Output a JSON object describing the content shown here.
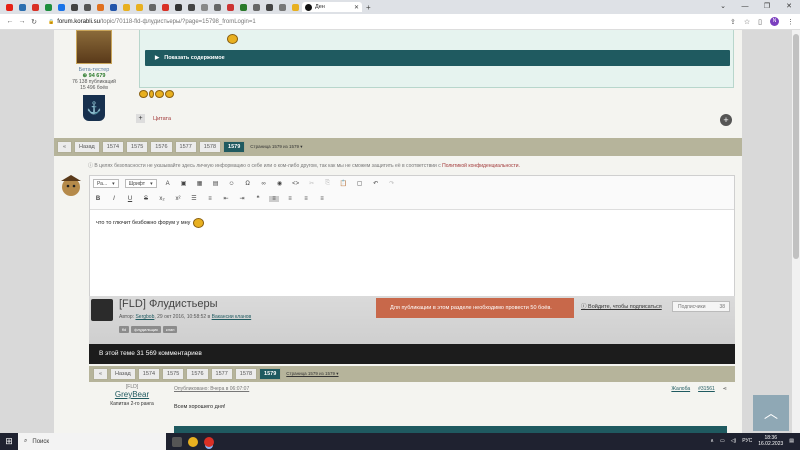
{
  "browser": {
    "active_tab_label": "Ден",
    "url_host": "forum.korabli.su",
    "url_path": "/topic/70118-fld-флудистьеры/?page=15798_fromLogin=1",
    "profile_initial": "N"
  },
  "post1": {
    "user_role": "Бета-тестер",
    "reputation": "94 679",
    "publications": "76 138 публикаций",
    "battles": "15 496 боёв",
    "spoiler_label": "Показать содержимое",
    "quote_label": "Цитата"
  },
  "pagination_top": {
    "back": "Назад",
    "pages": [
      "1574",
      "1575",
      "1576",
      "1577",
      "1578",
      "1579"
    ],
    "of_label": "Страница 1579 из 1579 ▾"
  },
  "privacy": {
    "text": "В целях безопасности не указывайте здесь личную информацию о себе или о ком-либо другом, так как мы не сможем защитить её в соответствии с",
    "link": "Политикой конфиденциальности."
  },
  "editor": {
    "font_size_select": "Ра...",
    "font_select": "Шрифт",
    "text": "что то глючит безбожно форум у мну"
  },
  "topic": {
    "title": "[FLD] Флудистьеры",
    "author_prefix": "Автор:",
    "author": "Sergbob",
    "date": ", 29 окт 2016, 10:58:52 в",
    "section": "Вакансии кланов",
    "tags": [
      "fld",
      "флудильщик",
      "клан"
    ],
    "warning": "Для публикации в этом разделе необходимо провести 50 боёв.",
    "follow": "Войдите, чтобы подписаться",
    "subscribers": "Подписчики",
    "subscribers_count": "38",
    "comments": "В этой теме 31 569 комментариев"
  },
  "post2": {
    "group": "[FLD]",
    "user": "GreyBear",
    "rank": "Капитан 2-го ранга",
    "date": "Опубликовано: Вчера в 06:07:07",
    "text": "Всем хорошего дня!",
    "report": "Жалоба",
    "post_id": "#31561"
  },
  "taskbar": {
    "search": "Поиск",
    "lang": "РУС",
    "time": "18:36",
    "date": "16.02.2023"
  }
}
